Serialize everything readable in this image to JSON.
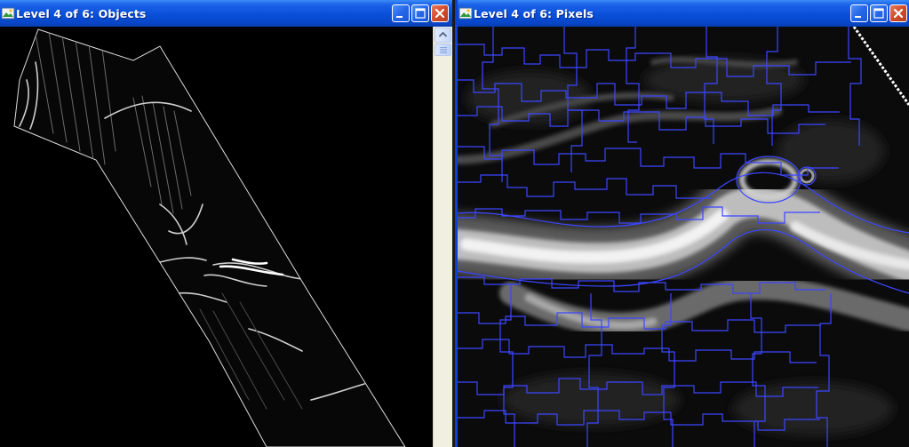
{
  "windows": [
    {
      "title": "Level 4 of 6: Objects"
    },
    {
      "title": "Level 4 of 6: Pixels"
    }
  ],
  "icons": {
    "app": "app-icon",
    "minimize": "minimize-icon",
    "maximize": "maximize-icon",
    "close": "close-icon"
  },
  "colors": {
    "titlebar": "#0a4fd9",
    "close_button": "#d34b2a",
    "segment_outline": "#3c46ff",
    "image_background": "#000000"
  }
}
